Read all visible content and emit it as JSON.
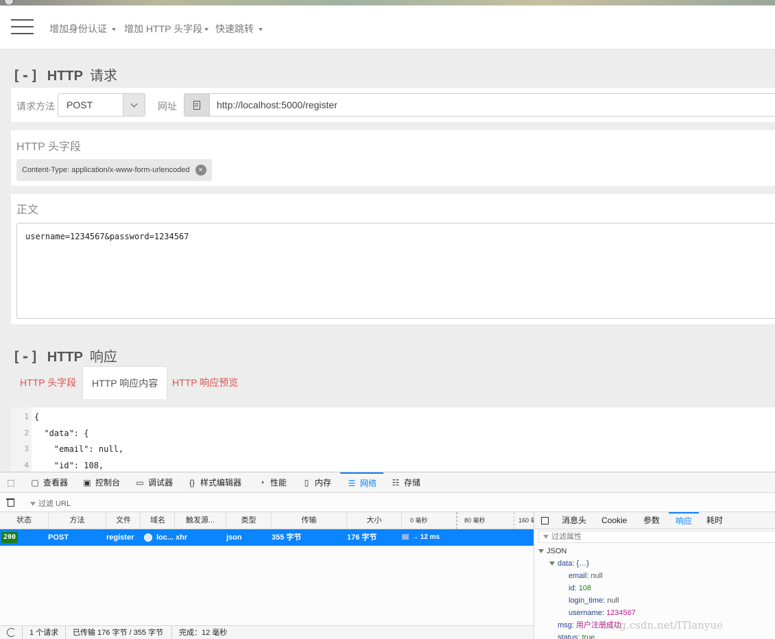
{
  "navbar": {
    "items": [
      {
        "label": "增加身份认证"
      },
      {
        "label": "增加 HTTP 头字段"
      },
      {
        "label": "快速跳转"
      }
    ]
  },
  "request": {
    "title_bracket": "[-]",
    "title_main": "HTTP",
    "title_sub": "请求",
    "method_label": "请求方法",
    "method_value": "POST",
    "url_label": "网址",
    "url_value": "http://localhost:5000/register",
    "headers_heading": "HTTP 头字段",
    "header_chip": "Content-Type: application/x-www-form-urlencoded",
    "header_chip_close": "×",
    "body_heading": "正文",
    "body_value": "username=1234567&password=1234567"
  },
  "response": {
    "title_bracket": "[-]",
    "title_main": "HTTP",
    "title_sub": "响应",
    "tabs": [
      {
        "label": "HTTP 头字段"
      },
      {
        "label": "HTTP 响应内容"
      },
      {
        "label": "HTTP 响应预览"
      }
    ],
    "code_lines": [
      {
        "n": "1",
        "text": "{"
      },
      {
        "n": "2",
        "text": "  \"data\": {"
      },
      {
        "n": "3",
        "text": "    \"email\": null,"
      },
      {
        "n": "4",
        "text": "    \"id\": 108,"
      }
    ]
  },
  "devtools": {
    "tabs": [
      {
        "label": "查看器",
        "icon": "inspector-icon"
      },
      {
        "label": "控制台",
        "icon": "console-icon"
      },
      {
        "label": "调试器",
        "icon": "debugger-icon"
      },
      {
        "label": "样式编辑器",
        "icon": "style-editor-icon"
      },
      {
        "label": "性能",
        "icon": "performance-icon"
      },
      {
        "label": "内存",
        "icon": "memory-icon"
      },
      {
        "label": "网络",
        "icon": "network-icon"
      },
      {
        "label": "存储",
        "icon": "storage-icon"
      }
    ],
    "active_tab": "网络",
    "filter_url": "过滤 URL",
    "columns": [
      "状态",
      "方法",
      "文件",
      "域名",
      "触发源...",
      "类型",
      "传输",
      "大小",
      "0 毫秒",
      "80 毫秒",
      "160 毫"
    ],
    "request_row": {
      "status": "200",
      "method": "POST",
      "file": "register",
      "domain": "loc...",
      "cause": "xhr",
      "type": "json",
      "transferred": "355 字节",
      "size": "176 字节",
      "timing": "→ 12 ms"
    },
    "side_tabs": [
      "消息头",
      "Cookie",
      "参数",
      "响应",
      "耗时"
    ],
    "side_active": "响应",
    "filter_props": "过滤属性",
    "json_root": "JSON",
    "json_data_key": "data:",
    "json_data_collapsed": "{…}",
    "json_fields": [
      {
        "key": "email:",
        "value": "null",
        "kind": "null"
      },
      {
        "key": "id:",
        "value": "108",
        "kind": "num"
      },
      {
        "key": "login_time:",
        "value": "null",
        "kind": "null"
      },
      {
        "key": "username:",
        "value": "1234567",
        "kind": "str"
      }
    ],
    "json_msg_key": "msg:",
    "json_msg_value": "用户注册成功",
    "json_status_key": "status:",
    "json_status_value": "true",
    "statusbar": {
      "requests": "1 个请求",
      "transferred": "已传输 176 字节 / 355 字节",
      "finished": "完成：12 毫秒"
    },
    "watermark": "blog.csdn.net/ITlanyue"
  }
}
